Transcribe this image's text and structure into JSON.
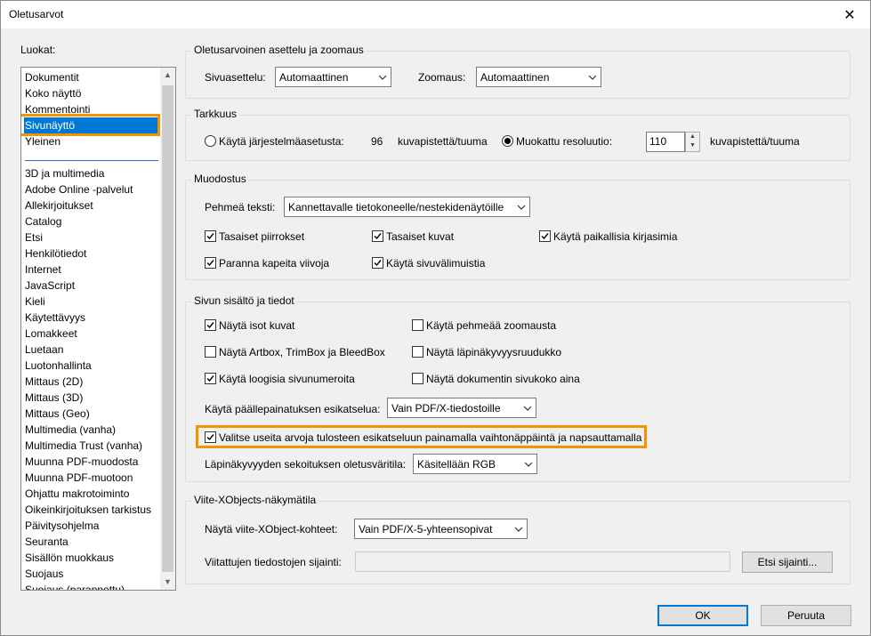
{
  "window": {
    "title": "Oletusarvot",
    "close_glyph": "✕"
  },
  "categories_label": "Luokat:",
  "categories_top": [
    "Dokumentit",
    "Koko näyttö",
    "Kommentointi",
    "Sivunäyttö",
    "Yleinen"
  ],
  "categories_rest": [
    "3D ja multimedia",
    "Adobe Online -palvelut",
    "Allekirjoitukset",
    "Catalog",
    "Etsi",
    "Henkilötiedot",
    "Internet",
    "JavaScript",
    "Kieli",
    "Käytettävyys",
    "Lomakkeet",
    "Luetaan",
    "Luotonhallinta",
    "Mittaus (2D)",
    "Mittaus (3D)",
    "Mittaus (Geo)",
    "Multimedia (vanha)",
    "Multimedia Trust (vanha)",
    "Muunna PDF-muodosta",
    "Muunna PDF-muotoon",
    "Ohjattu makrotoiminto",
    "Oikeinkirjoituksen tarkistus",
    "Päivitysohjelma",
    "Seuranta",
    "Sisällön muokkaus",
    "Suojaus",
    "Suojaus (parannettu)"
  ],
  "selected_category": "Sivunäyttö",
  "layout_group": {
    "title": "Oletusarvoinen asettelu ja zoomaus",
    "page_layout_label": "Sivuasettelu:",
    "page_layout_value": "Automaattinen",
    "zoom_label": "Zoomaus:",
    "zoom_value": "Automaattinen"
  },
  "resolution_group": {
    "title": "Tarkkuus",
    "system_label": "Käytä järjestelmäasetusta:",
    "system_value": "96",
    "system_unit": "kuvapistettä/tuuma",
    "custom_label": "Muokattu resoluutio:",
    "custom_value": "110",
    "custom_unit": "kuvapistettä/tuuma"
  },
  "rendering_group": {
    "title": "Muodostus",
    "smooth_text_label": "Pehmeä teksti:",
    "smooth_text_value": "Kannettavalle tietokoneelle/nestekidenäytöille",
    "smooth_lineart": "Tasaiset piirrokset",
    "smooth_images": "Tasaiset kuvat",
    "local_fonts": "Käytä paikallisia kirjasimia",
    "enhance_thin_lines": "Paranna kapeita viivoja",
    "page_cache": "Käytä sivuvälimuistia"
  },
  "content_group": {
    "title": "Sivun sisältö ja tiedot",
    "show_large_images": "Näytä isot kuvat",
    "smooth_zoom": "Käytä pehmeää zoomausta",
    "show_artbox": "Näytä Artbox, TrimBox ja BleedBox",
    "transparency_grid": "Näytä läpinäkyvyysruudukko",
    "logical_page_numbers": "Käytä loogisia sivunumeroita",
    "always_show_doc_size": "Näytä dokumentin sivukoko aina",
    "overprint_label": "Käytä päällepainatuksen esikatselua:",
    "overprint_value": "Vain PDF/X-tiedostoille",
    "multi_select": "Valitse useita arvoja tulosteen esikatseluun painamalla vaihtonäppäintä ja napsauttamalla",
    "blend_label": "Läpinäkyvyyden sekoituksen oletusväritila:",
    "blend_value": "Käsitellään RGB"
  },
  "xobject_group": {
    "title": "Viite-XObjects-näkymätila",
    "show_label": "Näytä viite-XObject-kohteet:",
    "show_value": "Vain PDF/X-5-yhteensopivat",
    "location_label": "Viitattujen tiedostojen sijainti:",
    "location_value": "",
    "browse_button": "Etsi sijainti..."
  },
  "buttons": {
    "ok": "OK",
    "cancel": "Peruuta"
  },
  "colors": {
    "accent": "#0078d7",
    "highlight": "#f29400"
  }
}
